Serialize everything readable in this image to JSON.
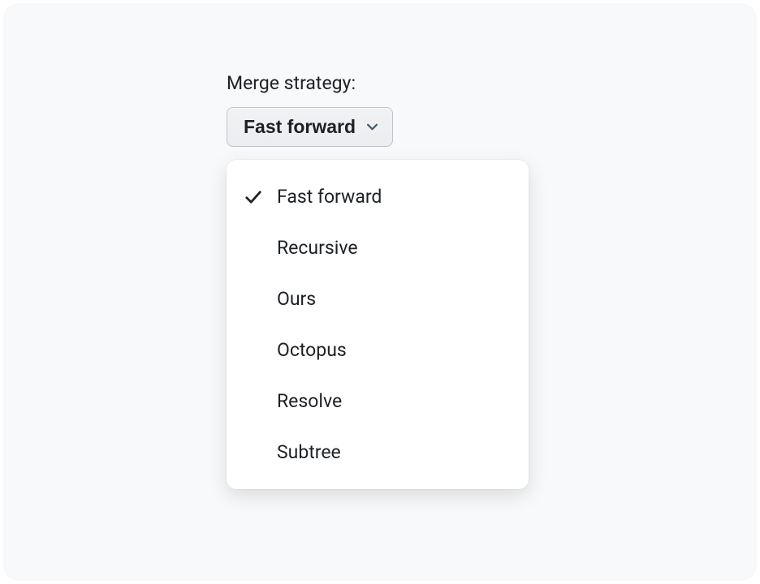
{
  "label": "Merge strategy:",
  "selected": "Fast forward",
  "options": [
    {
      "label": "Fast forward",
      "selected": true
    },
    {
      "label": "Recursive",
      "selected": false
    },
    {
      "label": "Ours",
      "selected": false
    },
    {
      "label": "Octopus",
      "selected": false
    },
    {
      "label": "Resolve",
      "selected": false
    },
    {
      "label": "Subtree",
      "selected": false
    }
  ]
}
